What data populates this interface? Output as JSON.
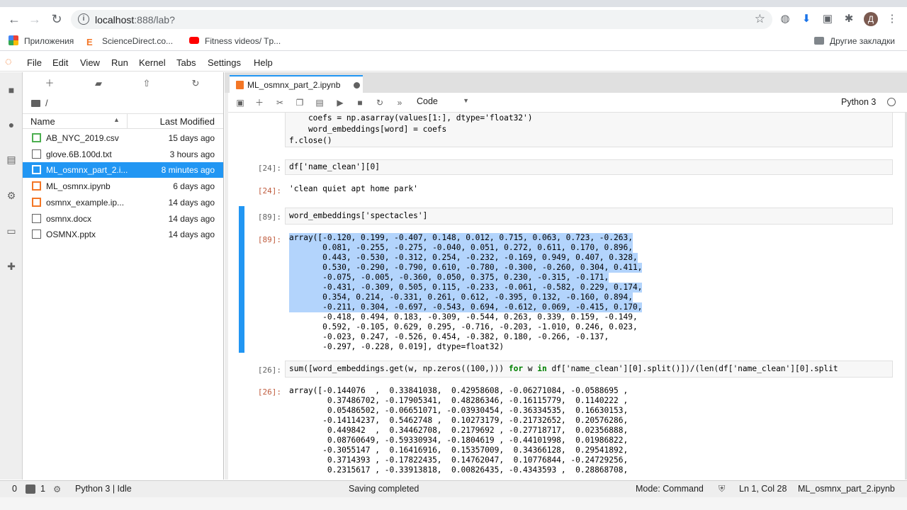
{
  "browser": {
    "url_host": "localhost",
    "url_rest": ":888/lab?",
    "bookmarks": [
      "Приложения",
      "ScienceDirect.co...",
      "Fitness videos/ Tp..."
    ],
    "other_bookmarks": "Другие закладки",
    "profile_initial": "Д"
  },
  "menubar": {
    "items": [
      "File",
      "Edit",
      "View",
      "Run",
      "Kernel",
      "Tabs",
      "Settings",
      "Help"
    ]
  },
  "filebrowser": {
    "breadcrumb": "/",
    "col_name": "Name",
    "col_modified": "Last Modified",
    "files": [
      {
        "name": "AB_NYC_2019.csv",
        "modified": "15 days ago",
        "icon": "csv-icon"
      },
      {
        "name": "glove.6B.100d.txt",
        "modified": "3 hours ago",
        "icon": "text-file-icon"
      },
      {
        "name": "ML_osmnx_part_2.i...",
        "modified": "8 minutes ago",
        "icon": "notebook-icon"
      },
      {
        "name": "ML_osmnx.ipynb",
        "modified": "6 days ago",
        "icon": "notebook-icon"
      },
      {
        "name": "osmnx_example.ip...",
        "modified": "14 days ago",
        "icon": "notebook-icon"
      },
      {
        "name": "osmnx.docx",
        "modified": "14 days ago",
        "icon": "text-file-icon"
      },
      {
        "name": "OSMNX.pptx",
        "modified": "14 days ago",
        "icon": "text-file-icon"
      }
    ]
  },
  "editor": {
    "tab_title": "ML_osmnx_part_2.ipynb",
    "cell_type": "Code",
    "kernel": "Python 3"
  },
  "cells": {
    "c0_lines": [
      "    coefs = np.asarray(values[1:], dtype='float32')",
      "    word_embeddings[word] = coefs",
      "f.close()"
    ],
    "c24_in_prompt": "[24]:",
    "c24_in": "df['name_clean'][0]",
    "c24_out_prompt": "[24]:",
    "c24_out": "'clean quiet apt home park'",
    "c89_in_prompt": "[89]:",
    "c89_in": "word_embeddings['spectacles']",
    "c89_out_prompt": "[89]:",
    "c89_out_lines": [
      "array([-0.120, 0.199, -0.407, 0.148, 0.012, 0.715, 0.063, 0.723, -0.263,",
      "       0.081, -0.255, -0.275, -0.040, 0.051, 0.272, 0.611, 0.170, 0.896,",
      "       0.443, -0.530, -0.312, 0.254, -0.232, -0.169, 0.949, 0.407, 0.328,",
      "       0.530, -0.290, -0.790, 0.610, -0.780, -0.300, -0.260, 0.304, 0.411,",
      "       -0.075, -0.005, -0.360, 0.050, 0.375, 0.230, -0.315, -0.171,",
      "       -0.431, -0.309, 0.505, 0.115, -0.233, -0.061, -0.582, 0.229, 0.174,",
      "       0.354, 0.214, -0.331, 0.261, 0.612, -0.395, 0.132, -0.160, 0.894,",
      "       -0.211, 0.304, -0.697, -0.543, 0.694, -0.612, 0.069, -0.415, 0.170,",
      "       -0.418, 0.494, 0.183, -0.309, -0.544, 0.263, 0.339, 0.159, -0.149,",
      "       0.592, -0.105, 0.629, 0.295, -0.716, -0.203, -1.010, 0.246, 0.023,",
      "       -0.023, 0.247, -0.526, 0.454, -0.382, 0.180, -0.266, -0.137,",
      "       -0.297, -0.228, 0.019], dtype=float32)"
    ],
    "c26_in_prompt": "[26]:",
    "c26_in_a": "sum([word_embeddings.get(w, np.zeros((100,))) ",
    "c26_in_kw1": "for",
    "c26_in_b": " w ",
    "c26_in_kw2": "in",
    "c26_in_c": " df['name_clean'][0].split()])/(len(df['name_clean'][0].split",
    "c26_out_prompt": "[26]:",
    "c26_out_lines": [
      "array([-0.144076  ,  0.33841038,  0.42958608, -0.06271084, -0.0588695 ,",
      "        0.37486702, -0.17905341,  0.48286346, -0.16115779,  0.1140222 ,",
      "        0.05486502, -0.06651071, -0.03930454, -0.36334535,  0.16630153,",
      "       -0.14114237,  0.5462748 ,  0.10273179, -0.21732652,  0.20576286,",
      "        0.449842  ,  0.34462708,  0.2179692 , -0.27718717,  0.02356888,",
      "        0.08760649, -0.59330934, -0.1804619 , -0.44101998,  0.01986822,",
      "       -0.3055147 ,  0.16416916,  0.15357009,  0.34366128,  0.29541892,",
      "        0.3714393 , -0.17822435,  0.14762047,  0.10776844, -0.24729256,",
      "        0.2315617 , -0.33913818,  0.00826435, -0.4343593 ,  0.28868708,"
    ]
  },
  "statusbar": {
    "terminals": "0",
    "kernels": "1",
    "kernel_status": "Python 3 | Idle",
    "message": "Saving completed",
    "mode": "Mode: Command",
    "position": "Ln 1, Col 28",
    "filename": "ML_osmnx_part_2.ipynb"
  },
  "colors": {
    "accent": "#2196f3",
    "jupyter_orange": "#f37626",
    "selection": "#b3d4fc"
  }
}
